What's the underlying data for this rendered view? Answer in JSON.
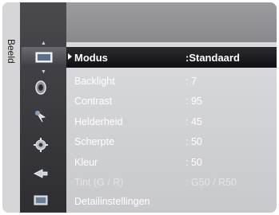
{
  "tab": {
    "label": "Beeld"
  },
  "icons": [
    "picture-icon",
    "sound-icon",
    "channel-icon",
    "setup-icon",
    "input-icon",
    "application-icon"
  ],
  "menu": {
    "items": [
      {
        "label": "Modus",
        "value": ":Standaard"
      },
      {
        "label": "Backlight",
        "value": ": 7"
      },
      {
        "label": "Contrast",
        "value": ": 95"
      },
      {
        "label": "Helderheid",
        "value": ": 45"
      },
      {
        "label": "Scherpte",
        "value": ": 50"
      },
      {
        "label": "Kleur",
        "value": ": 50"
      },
      {
        "label": "Tint (G / R)",
        "value": ": G50 / R50"
      },
      {
        "label": "Detailinstellingen",
        "value": ""
      }
    ]
  },
  "colors": {
    "selected_row": "#1a1a1e",
    "rows_bg": "#d0d1d4",
    "icon_column": "#3a3a3e"
  }
}
